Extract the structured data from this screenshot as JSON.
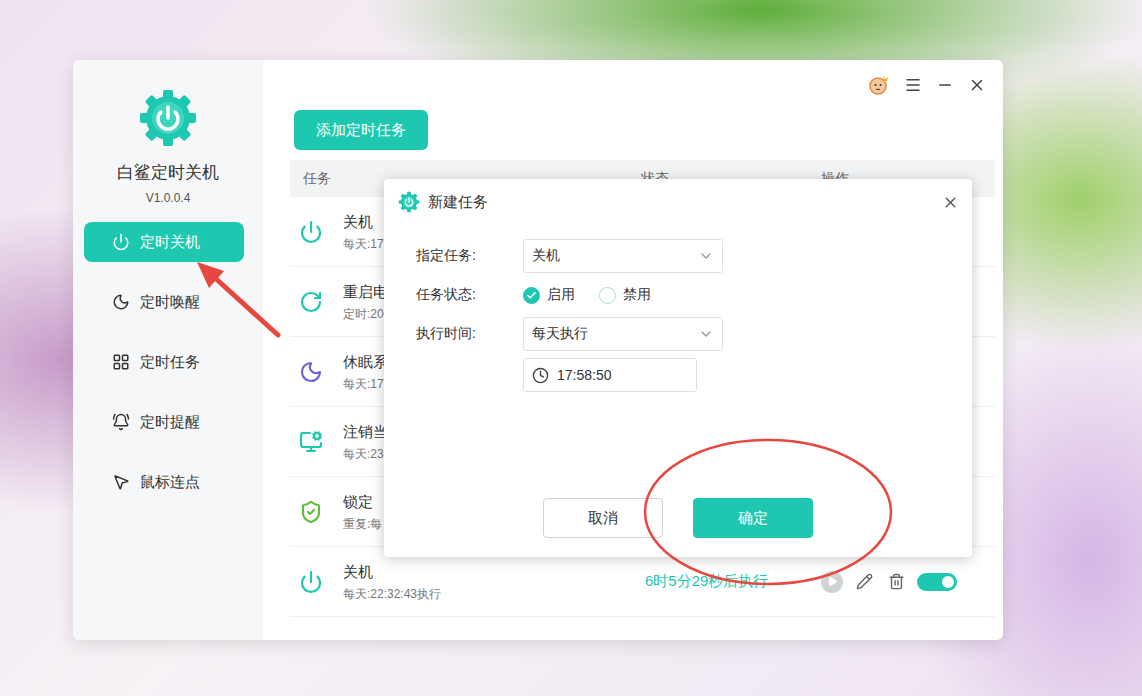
{
  "app": {
    "name": "白鲨定时关机",
    "version": "V1.0.0.4"
  },
  "sidebar": {
    "items": [
      {
        "label": "定时关机",
        "selected": true
      },
      {
        "label": "定时唤醒",
        "selected": false
      },
      {
        "label": "定时任务",
        "selected": false
      },
      {
        "label": "定时提醒",
        "selected": false
      },
      {
        "label": "鼠标连点",
        "selected": false
      }
    ]
  },
  "toolbar": {
    "add_button": "添加定时任务"
  },
  "table": {
    "columns": [
      "任务",
      "状态",
      "操作"
    ],
    "rows": [
      {
        "name": "关机",
        "schedule": "每天:17"
      },
      {
        "name": "重启电",
        "schedule": "定时:20"
      },
      {
        "name": "休眠系",
        "schedule": "每天:17"
      },
      {
        "name": "注销当",
        "schedule": "每天:23"
      },
      {
        "name": "锁定",
        "schedule": "重复:每"
      },
      {
        "name": "关机",
        "schedule": "每天:22:32:43执行",
        "status": "6时5分29秒后执行",
        "enabled": true
      }
    ]
  },
  "dialog": {
    "title": "新建任务",
    "fields": [
      {
        "label": "指定任务:",
        "kind": "select",
        "value": "关机"
      },
      {
        "label": "任务状态:",
        "kind": "radio",
        "options": [
          {
            "label": "启用",
            "selected": true
          },
          {
            "label": "禁用",
            "selected": false
          }
        ]
      },
      {
        "label": "执行时间:",
        "kind": "select",
        "value": "每天执行",
        "time": "17:58:50"
      }
    ],
    "buttons": [
      {
        "label": "取消",
        "primary": false
      },
      {
        "label": "确定",
        "primary": true
      }
    ]
  }
}
